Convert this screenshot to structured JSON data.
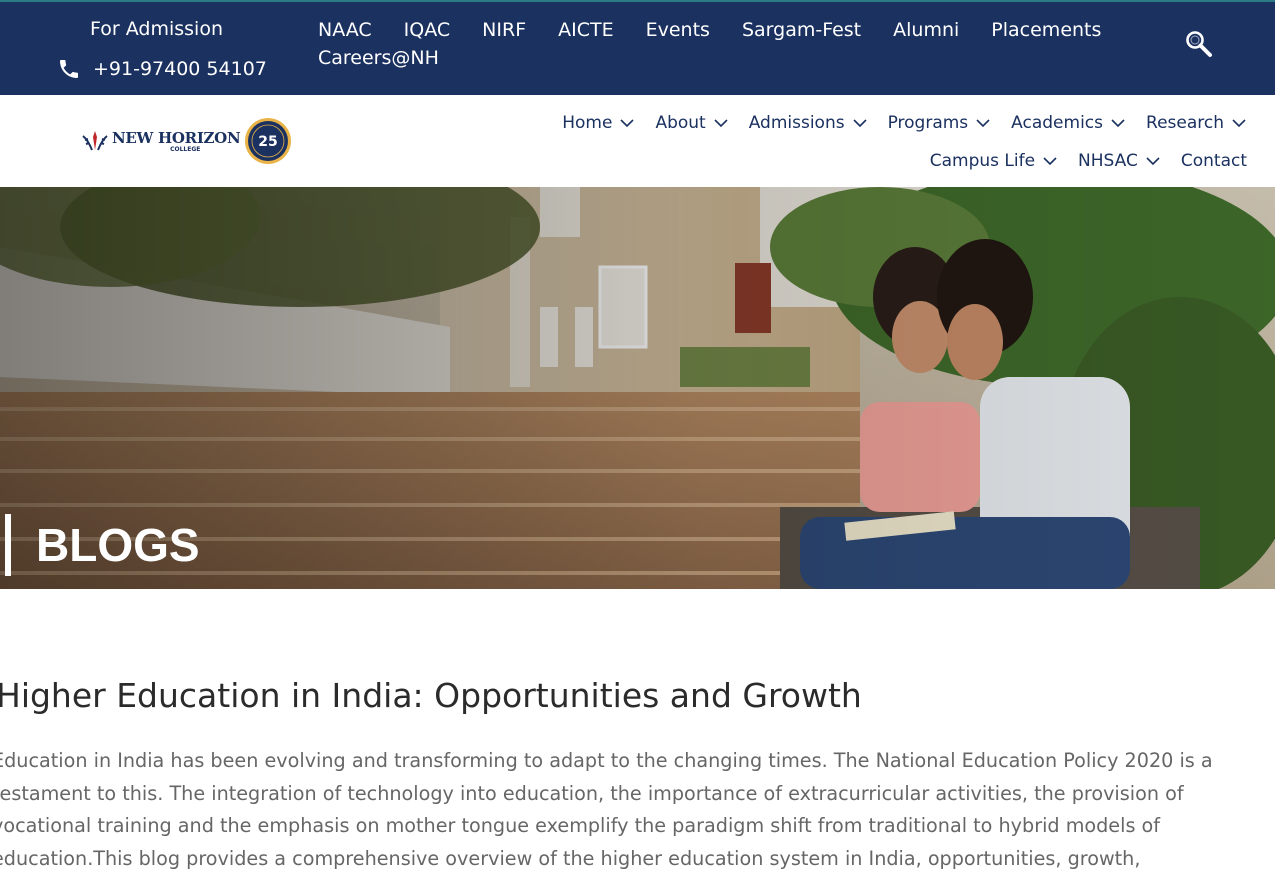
{
  "topbar": {
    "admission_label": "For Admission",
    "phone": "+91-97400 54107",
    "links": [
      "NAAC",
      "IQAC",
      "NIRF",
      "AICTE",
      "Events",
      "Sargam-Fest",
      "Alumni",
      "Placements",
      "Careers@NH"
    ]
  },
  "logo": {
    "main": "NEW HORIZON",
    "sub": "COLLEGE",
    "badge": "25"
  },
  "nav": {
    "items": [
      "Home",
      "About",
      "Admissions",
      "Programs",
      "Academics",
      "Research",
      "Campus Life",
      "NHSAC",
      "Contact"
    ]
  },
  "hero": {
    "title": "BLOGS"
  },
  "article": {
    "title": "Higher Education in India: Opportunities and Growth",
    "body": "Education in India has been evolving and transforming to adapt to the changing times. The National Education Policy 2020 is a testament to this. The integration of technology into education, the importance of extracurricular activities, the provision of vocational training and the emphasis on mother tongue exemplify the paradigm shift from traditional to hybrid models of education.This blog provides a comprehensive overview of the higher education system in India, opportunities, growth,"
  },
  "colors": {
    "navy": "#1b3160",
    "accent": "#2a7b86"
  },
  "icons": [
    "phone-icon",
    "search-icon",
    "chevron-down-icon",
    "crest-icon",
    "anniversary-badge"
  ]
}
